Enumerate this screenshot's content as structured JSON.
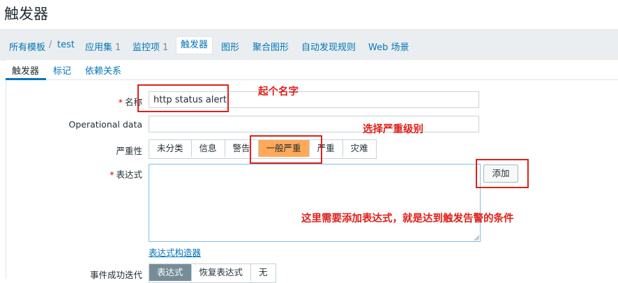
{
  "page": {
    "title": "触发器"
  },
  "nav": {
    "all_templates": "所有模板",
    "separator": "/",
    "template_name": "test",
    "applications": "应用集",
    "applications_count": "1",
    "items": "监控项",
    "items_count": "1",
    "triggers": "触发器",
    "graphs": "图形",
    "screens": "聚合图形",
    "discovery": "自动发现规则",
    "web": "Web 场景"
  },
  "tabs": {
    "trigger": "触发器",
    "tags": "标记",
    "dependencies": "依赖关系"
  },
  "form": {
    "name_label": "名称",
    "name_value": "http status alert",
    "required_mark": "*",
    "opdata_label": "Operational data",
    "opdata_value": "",
    "severity_label": "严重性",
    "severity_options": [
      "未分类",
      "信息",
      "警告",
      "一般严重",
      "严重",
      "灾难"
    ],
    "severity_selected": "一般严重",
    "expression_label": "表达式",
    "expression_value": "",
    "add_button": "添加",
    "expression_builder_link": "表达式构造器",
    "recovery_label": "事件成功迭代",
    "recovery_options": [
      "表达式",
      "恢复表达式",
      "无"
    ],
    "recovery_selected": "表达式"
  },
  "annotations": {
    "name_note": "起个名字",
    "severity_note": "选择严重级别",
    "expression_note": "这里需要添加表达式，就是达到触发告警的条件"
  },
  "colors": {
    "link": "#0275b8",
    "annotation": "#e0201a",
    "severity_selected_bg": "#ffa959",
    "recovery_selected_bg": "#768d99"
  }
}
